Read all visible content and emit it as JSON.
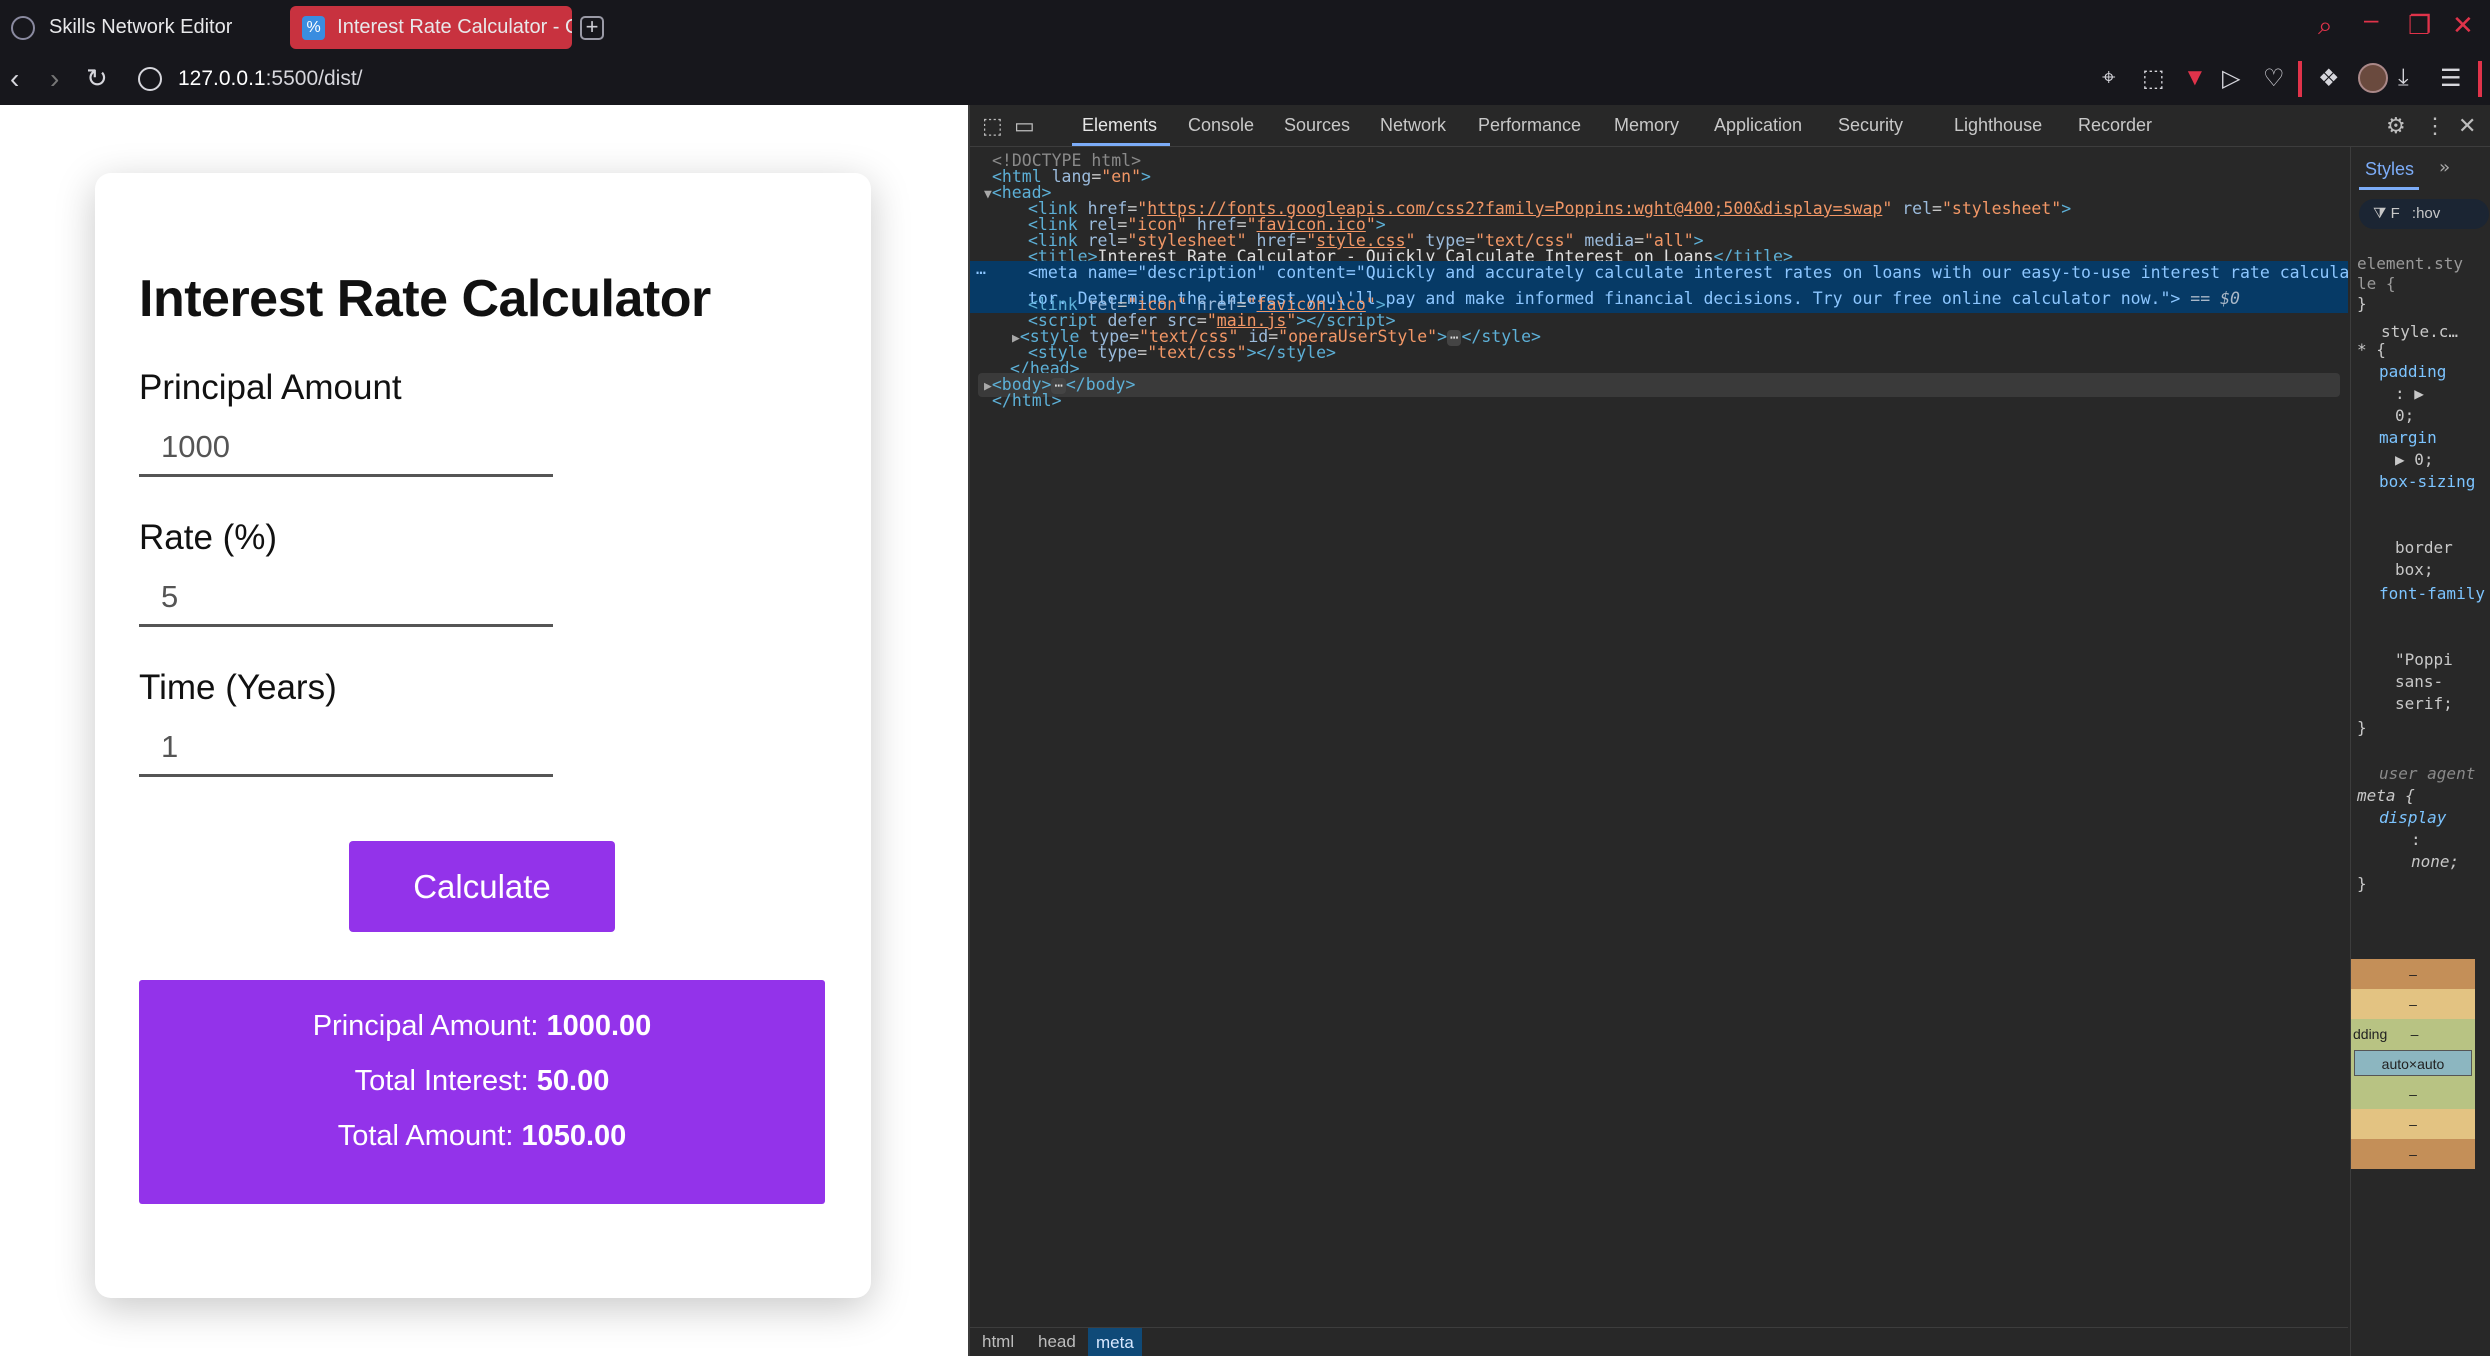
{
  "browser": {
    "tabs": [
      {
        "label": "Skills Network Editor",
        "icon": "skills-network-icon"
      },
      {
        "label": "Interest Rate Calculator - Q",
        "icon": "percent-icon",
        "active": true
      }
    ],
    "url_host": "127.0.0.1",
    "url_rest": ":5500/dist/"
  },
  "page": {
    "title": "Interest Rate Calculator",
    "fields": [
      {
        "label": "Principal Amount",
        "value": "1000"
      },
      {
        "label": "Rate (%)",
        "value": "5"
      },
      {
        "label": "Time (Years)",
        "value": "1"
      }
    ],
    "button_label": "Calculate",
    "results": [
      {
        "label": "Principal Amount:",
        "value": "1000.00"
      },
      {
        "label": "Total Interest:",
        "value": "50.00"
      },
      {
        "label": "Total Amount:",
        "value": "1050.00"
      }
    ],
    "accent_color": "#9333ea"
  },
  "devtools": {
    "tabs": [
      "Elements",
      "Console",
      "Sources",
      "Network",
      "Performance",
      "Memory",
      "Application",
      "Security",
      "Lighthouse",
      "Recorder"
    ],
    "active_tab": "Elements",
    "breadcrumbs": [
      "html",
      "head",
      "meta"
    ],
    "dom": {
      "doctype": "<!DOCTYPE html>",
      "fonts_href": "https://fonts.googleapis.com/css2?family=Poppins:wght@400;500&display=swap",
      "favicon_href": "favicon.ico",
      "style_href": "style.css",
      "title_text": "Interest Rate Calculator - Quickly Calculate Interest on Loans",
      "meta_content_line1": "Quickly and accurately calculate interest rates on loans with our easy-to-use interest rate calcula",
      "meta_content_line2": "tor. Determine the interest you\\'ll pay and make informed financial decisions. Try our free online calculator now.",
      "selected_marker": "== $0",
      "script_src": "main.js",
      "opera_style_id": "operaUserStyle"
    },
    "styles": {
      "tab": "Styles",
      "filter_placeholder": "F",
      "hov": ":hov",
      "element_style": "element.sty",
      "element_style2": "le {",
      "rule_source": "style.c…",
      "props": [
        {
          "name": "padding",
          "value": "0;"
        },
        {
          "name": "margin",
          "value": "0;"
        },
        {
          "name": "box-sizing",
          "value": "border box;"
        },
        {
          "name": "font-family",
          "value": "\"Poppi sans-serif;"
        }
      ],
      "ua_label": "user agent",
      "ua_selector": "meta {",
      "ua_prop": "display",
      "ua_value": "none;",
      "box_padding_label": "dding",
      "box_content": "auto×auto",
      "box_dash": "–"
    }
  }
}
